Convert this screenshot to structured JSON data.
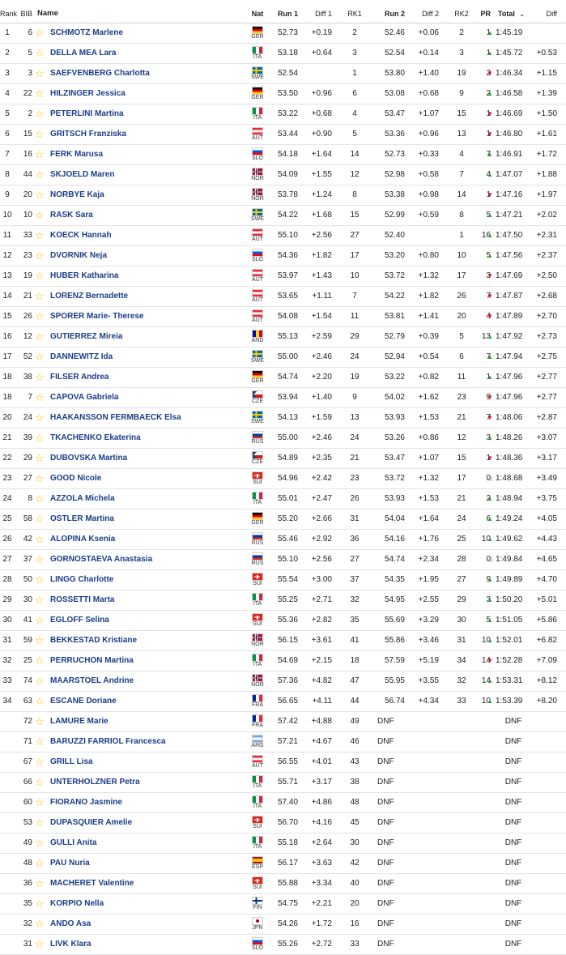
{
  "columns": {
    "rank": "Rank",
    "bib": "BIB",
    "name": "Name",
    "nat": "Nat",
    "run1": "Run 1",
    "diff1": "Diff 1",
    "rk1": "RK1",
    "run2": "Run 2",
    "diff2": "Diff 2",
    "rk2": "RK2",
    "pr": "PR",
    "total": "Total",
    "diff": "Diff"
  },
  "icons": {
    "favorite": "star-outline-icon",
    "up": "triangle-up-icon",
    "down": "triangle-down-icon",
    "same": "triangle-left-outline-icon",
    "sort": "sort-caret-icon"
  },
  "colors": {
    "star": "#f2c200",
    "name": "#1a3d8a",
    "up": "#2e9b2e",
    "down": "#d11414"
  },
  "finishers": [
    {
      "rank": "1",
      "bib": "6",
      "name": "SCHMOTZ Marlene",
      "nat": "GER",
      "run1": "52.73",
      "diff1": "+0.19",
      "rk1": "2",
      "run2": "52.46",
      "diff2": "+0.06",
      "rk2": "2",
      "pr": "1",
      "dir": "up",
      "total": "1:45.19",
      "diff": ""
    },
    {
      "rank": "2",
      "bib": "5",
      "name": "DELLA MEA Lara",
      "nat": "ITA",
      "run1": "53.18",
      "diff1": "+0.64",
      "rk1": "3",
      "run2": "52.54",
      "diff2": "+0.14",
      "rk2": "3",
      "pr": "1",
      "dir": "up",
      "total": "1:45.72",
      "diff": "+0.53"
    },
    {
      "rank": "3",
      "bib": "3",
      "name": "SAEFVENBERG Charlotta",
      "nat": "SWE",
      "run1": "52.54",
      "diff1": "",
      "rk1": "1",
      "run2": "53.80",
      "diff2": "+1.40",
      "rk2": "19",
      "pr": "2",
      "dir": "down",
      "total": "1:46.34",
      "diff": "+1.15"
    },
    {
      "rank": "4",
      "bib": "22",
      "name": "HILZINGER Jessica",
      "nat": "GER",
      "run1": "53.50",
      "diff1": "+0.96",
      "rk1": "6",
      "run2": "53.08",
      "diff2": "+0.68",
      "rk2": "9",
      "pr": "2",
      "dir": "up",
      "total": "1:46.58",
      "diff": "+1.39"
    },
    {
      "rank": "5",
      "bib": "2",
      "name": "PETERLINI Martina",
      "nat": "ITA",
      "run1": "53.22",
      "diff1": "+0.68",
      "rk1": "4",
      "run2": "53.47",
      "diff2": "+1.07",
      "rk2": "15",
      "pr": "1",
      "dir": "down",
      "total": "1:46.69",
      "diff": "+1.50"
    },
    {
      "rank": "6",
      "bib": "15",
      "name": "GRITSCH Franziska",
      "nat": "AUT",
      "run1": "53.44",
      "diff1": "+0.90",
      "rk1": "5",
      "run2": "53.36",
      "diff2": "+0.96",
      "rk2": "13",
      "pr": "1",
      "dir": "down",
      "total": "1:46.80",
      "diff": "+1.61"
    },
    {
      "rank": "7",
      "bib": "16",
      "name": "FERK Marusa",
      "nat": "SLO",
      "run1": "54.18",
      "diff1": "+1.64",
      "rk1": "14",
      "run2": "52.73",
      "diff2": "+0.33",
      "rk2": "4",
      "pr": "7",
      "dir": "up",
      "total": "1:46.91",
      "diff": "+1.72"
    },
    {
      "rank": "8",
      "bib": "44",
      "name": "SKJOELD Maren",
      "nat": "NOR",
      "run1": "54.09",
      "diff1": "+1.55",
      "rk1": "12",
      "run2": "52.98",
      "diff2": "+0.58",
      "rk2": "7",
      "pr": "4",
      "dir": "up",
      "total": "1:47.07",
      "diff": "+1.88"
    },
    {
      "rank": "9",
      "bib": "20",
      "name": "NORBYE Kaja",
      "nat": "NOR",
      "run1": "53.78",
      "diff1": "+1.24",
      "rk1": "8",
      "run2": "53.38",
      "diff2": "+0.98",
      "rk2": "14",
      "pr": "1",
      "dir": "down",
      "total": "1:47.16",
      "diff": "+1.97"
    },
    {
      "rank": "10",
      "bib": "10",
      "name": "RASK Sara",
      "nat": "SWE",
      "run1": "54.22",
      "diff1": "+1.68",
      "rk1": "15",
      "run2": "52.99",
      "diff2": "+0.59",
      "rk2": "8",
      "pr": "5",
      "dir": "up",
      "total": "1:47.21",
      "diff": "+2.02"
    },
    {
      "rank": "11",
      "bib": "33",
      "name": "KOECK Hannah",
      "nat": "AUT",
      "run1": "55.10",
      "diff1": "+2.56",
      "rk1": "27",
      "run2": "52.40",
      "diff2": "",
      "rk2": "1",
      "pr": "16",
      "dir": "up",
      "total": "1:47.50",
      "diff": "+2.31"
    },
    {
      "rank": "12",
      "bib": "23",
      "name": "DVORNIK Neja",
      "nat": "SLO",
      "run1": "54.36",
      "diff1": "+1.82",
      "rk1": "17",
      "run2": "53.20",
      "diff2": "+0.80",
      "rk2": "10",
      "pr": "5",
      "dir": "up",
      "total": "1:47.56",
      "diff": "+2.37"
    },
    {
      "rank": "13",
      "bib": "19",
      "name": "HUBER Katharina",
      "nat": "AUT",
      "run1": "53.97",
      "diff1": "+1.43",
      "rk1": "10",
      "run2": "53.72",
      "diff2": "+1.32",
      "rk2": "17",
      "pr": "3",
      "dir": "down",
      "total": "1:47.69",
      "diff": "+2.50"
    },
    {
      "rank": "14",
      "bib": "21",
      "name": "LORENZ Bernadette",
      "nat": "AUT",
      "run1": "53.65",
      "diff1": "+1.11",
      "rk1": "7",
      "run2": "54.22",
      "diff2": "+1.82",
      "rk2": "26",
      "pr": "7",
      "dir": "down",
      "total": "1:47.87",
      "diff": "+2.68"
    },
    {
      "rank": "15",
      "bib": "26",
      "name": "SPORER Marie- Therese",
      "nat": "AUT",
      "run1": "54.08",
      "diff1": "+1.54",
      "rk1": "11",
      "run2": "53.81",
      "diff2": "+1.41",
      "rk2": "20",
      "pr": "4",
      "dir": "down",
      "total": "1:47.89",
      "diff": "+2.70"
    },
    {
      "rank": "16",
      "bib": "12",
      "name": "GUTIERREZ Mireia",
      "nat": "AND",
      "run1": "55.13",
      "diff1": "+2.59",
      "rk1": "29",
      "run2": "52.79",
      "diff2": "+0.39",
      "rk2": "5",
      "pr": "13",
      "dir": "up",
      "total": "1:47.92",
      "diff": "+2.73"
    },
    {
      "rank": "17",
      "bib": "52",
      "name": "DANNEWITZ Ida",
      "nat": "SWE",
      "run1": "55.00",
      "diff1": "+2.46",
      "rk1": "24",
      "run2": "52.94",
      "diff2": "+0.54",
      "rk2": "6",
      "pr": "7",
      "dir": "up",
      "total": "1:47.94",
      "diff": "+2.75"
    },
    {
      "rank": "18",
      "bib": "38",
      "name": "FILSER Andrea",
      "nat": "GER",
      "run1": "54.74",
      "diff1": "+2.20",
      "rk1": "19",
      "run2": "53.22",
      "diff2": "+0.82",
      "rk2": "11",
      "pr": "1",
      "dir": "up",
      "total": "1:47.96",
      "diff": "+2.77"
    },
    {
      "rank": "18",
      "bib": "7",
      "name": "CAPOVA Gabriela",
      "nat": "CZE",
      "run1": "53.94",
      "diff1": "+1.40",
      "rk1": "9",
      "run2": "54.02",
      "diff2": "+1.62",
      "rk2": "23",
      "pr": "9",
      "dir": "down",
      "total": "1:47.96",
      "diff": "+2.77"
    },
    {
      "rank": "20",
      "bib": "24",
      "name": "HAAKANSSON FERMBAECK Elsa",
      "nat": "SWE",
      "run1": "54.13",
      "diff1": "+1.59",
      "rk1": "13",
      "run2": "53.93",
      "diff2": "+1.53",
      "rk2": "21",
      "pr": "7",
      "dir": "down",
      "total": "1:48.06",
      "diff": "+2.87"
    },
    {
      "rank": "21",
      "bib": "39",
      "name": "TKACHENKO Ekaterina",
      "nat": "RUS",
      "run1": "55.00",
      "diff1": "+2.46",
      "rk1": "24",
      "run2": "53.26",
      "diff2": "+0.86",
      "rk2": "12",
      "pr": "3",
      "dir": "up",
      "total": "1:48.26",
      "diff": "+3.07"
    },
    {
      "rank": "22",
      "bib": "29",
      "name": "DUBOVSKA Martina",
      "nat": "CZE",
      "run1": "54.89",
      "diff1": "+2.35",
      "rk1": "21",
      "run2": "53.47",
      "diff2": "+1.07",
      "rk2": "15",
      "pr": "1",
      "dir": "down",
      "total": "1:48.36",
      "diff": "+3.17"
    },
    {
      "rank": "23",
      "bib": "27",
      "name": "GOOD Nicole",
      "nat": "SUI",
      "run1": "54.96",
      "diff1": "+2.42",
      "rk1": "23",
      "run2": "53.72",
      "diff2": "+1.32",
      "rk2": "17",
      "pr": "0",
      "dir": "same",
      "total": "1:48.68",
      "diff": "+3.49"
    },
    {
      "rank": "24",
      "bib": "8",
      "name": "AZZOLA Michela",
      "nat": "ITA",
      "run1": "55.01",
      "diff1": "+2.47",
      "rk1": "26",
      "run2": "53.93",
      "diff2": "+1.53",
      "rk2": "21",
      "pr": "2",
      "dir": "up",
      "total": "1:48.94",
      "diff": "+3.75"
    },
    {
      "rank": "25",
      "bib": "58",
      "name": "OSTLER Martina",
      "nat": "GER",
      "run1": "55.20",
      "diff1": "+2.66",
      "rk1": "31",
      "run2": "54.04",
      "diff2": "+1.64",
      "rk2": "24",
      "pr": "6",
      "dir": "up",
      "total": "1:49.24",
      "diff": "+4.05"
    },
    {
      "rank": "26",
      "bib": "42",
      "name": "ALOPINA Ksenia",
      "nat": "RUS",
      "run1": "55.46",
      "diff1": "+2.92",
      "rk1": "36",
      "run2": "54.16",
      "diff2": "+1.76",
      "rk2": "25",
      "pr": "10",
      "dir": "up",
      "total": "1:49.62",
      "diff": "+4.43"
    },
    {
      "rank": "27",
      "bib": "37",
      "name": "GORNOSTAEVA Anastasia",
      "nat": "RUS",
      "run1": "55.10",
      "diff1": "+2.56",
      "rk1": "27",
      "run2": "54.74",
      "diff2": "+2.34",
      "rk2": "28",
      "pr": "0",
      "dir": "same",
      "total": "1:49.84",
      "diff": "+4.65"
    },
    {
      "rank": "28",
      "bib": "50",
      "name": "LINGG Charlotte",
      "nat": "SUI",
      "run1": "55.54",
      "diff1": "+3.00",
      "rk1": "37",
      "run2": "54.35",
      "diff2": "+1.95",
      "rk2": "27",
      "pr": "9",
      "dir": "up",
      "total": "1:49.89",
      "diff": "+4.70"
    },
    {
      "rank": "29",
      "bib": "30",
      "name": "ROSSETTI Marta",
      "nat": "ITA",
      "run1": "55.25",
      "diff1": "+2.71",
      "rk1": "32",
      "run2": "54.95",
      "diff2": "+2.55",
      "rk2": "29",
      "pr": "3",
      "dir": "up",
      "total": "1:50.20",
      "diff": "+5.01"
    },
    {
      "rank": "30",
      "bib": "41",
      "name": "EGLOFF Selina",
      "nat": "SUI",
      "run1": "55.36",
      "diff1": "+2.82",
      "rk1": "35",
      "run2": "55.69",
      "diff2": "+3.29",
      "rk2": "30",
      "pr": "5",
      "dir": "up",
      "total": "1:51.05",
      "diff": "+5.86"
    },
    {
      "rank": "31",
      "bib": "59",
      "name": "BEKKESTAD Kristiane",
      "nat": "NOR",
      "run1": "56.15",
      "diff1": "+3.61",
      "rk1": "41",
      "run2": "55.86",
      "diff2": "+3.46",
      "rk2": "31",
      "pr": "10",
      "dir": "up",
      "total": "1:52.01",
      "diff": "+6.82"
    },
    {
      "rank": "32",
      "bib": "25",
      "name": "PERRUCHON Martina",
      "nat": "ITA",
      "run1": "54.69",
      "diff1": "+2.15",
      "rk1": "18",
      "run2": "57.59",
      "diff2": "+5.19",
      "rk2": "34",
      "pr": "14",
      "dir": "down",
      "total": "1:52.28",
      "diff": "+7.09"
    },
    {
      "rank": "33",
      "bib": "74",
      "name": "MAARSTOEL Andrine",
      "nat": "NOR",
      "run1": "57.36",
      "diff1": "+4.82",
      "rk1": "47",
      "run2": "55.95",
      "diff2": "+3.55",
      "rk2": "32",
      "pr": "14",
      "dir": "up",
      "total": "1:53.31",
      "diff": "+8.12"
    },
    {
      "rank": "34",
      "bib": "63",
      "name": "ESCANE Doriane",
      "nat": "FRA",
      "run1": "56.65",
      "diff1": "+4.11",
      "rk1": "44",
      "run2": "56.74",
      "diff2": "+4.34",
      "rk2": "33",
      "pr": "10",
      "dir": "up",
      "total": "1:53.39",
      "diff": "+8.20"
    }
  ],
  "dnf": [
    {
      "bib": "72",
      "name": "LAMURE Marie",
      "nat": "FRA",
      "run1": "57.42",
      "diff1": "+4.88",
      "rk1": "49",
      "run2": "DNF",
      "total": "DNF"
    },
    {
      "bib": "71",
      "name": "BARUZZI FARRIOL Francesca",
      "nat": "ARG",
      "run1": "57.21",
      "diff1": "+4.67",
      "rk1": "46",
      "run2": "DNF",
      "total": "DNF"
    },
    {
      "bib": "67",
      "name": "GRILL Lisa",
      "nat": "AUT",
      "run1": "56.55",
      "diff1": "+4.01",
      "rk1": "43",
      "run2": "DNF",
      "total": "DNF"
    },
    {
      "bib": "66",
      "name": "UNTERHOLZNER Petra",
      "nat": "ITA",
      "run1": "55.71",
      "diff1": "+3.17",
      "rk1": "38",
      "run2": "DNF",
      "total": "DNF"
    },
    {
      "bib": "60",
      "name": "FIORANO Jasmine",
      "nat": "ITA",
      "run1": "57.40",
      "diff1": "+4.86",
      "rk1": "48",
      "run2": "DNF",
      "total": "DNF"
    },
    {
      "bib": "53",
      "name": "DUPASQUIER Amelie",
      "nat": "SUI",
      "run1": "56.70",
      "diff1": "+4.16",
      "rk1": "45",
      "run2": "DNF",
      "total": "DNF"
    },
    {
      "bib": "49",
      "name": "GULLI Anita",
      "nat": "ITA",
      "run1": "55.18",
      "diff1": "+2.64",
      "rk1": "30",
      "run2": "DNF",
      "total": "DNF"
    },
    {
      "bib": "48",
      "name": "PAU Nuria",
      "nat": "ESP",
      "run1": "56.17",
      "diff1": "+3.63",
      "rk1": "42",
      "run2": "DNF",
      "total": "DNF"
    },
    {
      "bib": "36",
      "name": "MACHERET Valentine",
      "nat": "SUI",
      "run1": "55.88",
      "diff1": "+3.34",
      "rk1": "40",
      "run2": "DNF",
      "total": "DNF"
    },
    {
      "bib": "35",
      "name": "KORPIO Nella",
      "nat": "FIN",
      "run1": "54.75",
      "diff1": "+2.21",
      "rk1": "20",
      "run2": "DNF",
      "total": "DNF"
    },
    {
      "bib": "32",
      "name": "ANDO Asa",
      "nat": "JPN",
      "run1": "54.26",
      "diff1": "+1.72",
      "rk1": "16",
      "run2": "DNF",
      "total": "DNF"
    },
    {
      "bib": "31",
      "name": "LIVK Klara",
      "nat": "SLO",
      "run1": "55.26",
      "diff1": "+2.72",
      "rk1": "33",
      "run2": "DNF",
      "total": "DNF"
    }
  ]
}
